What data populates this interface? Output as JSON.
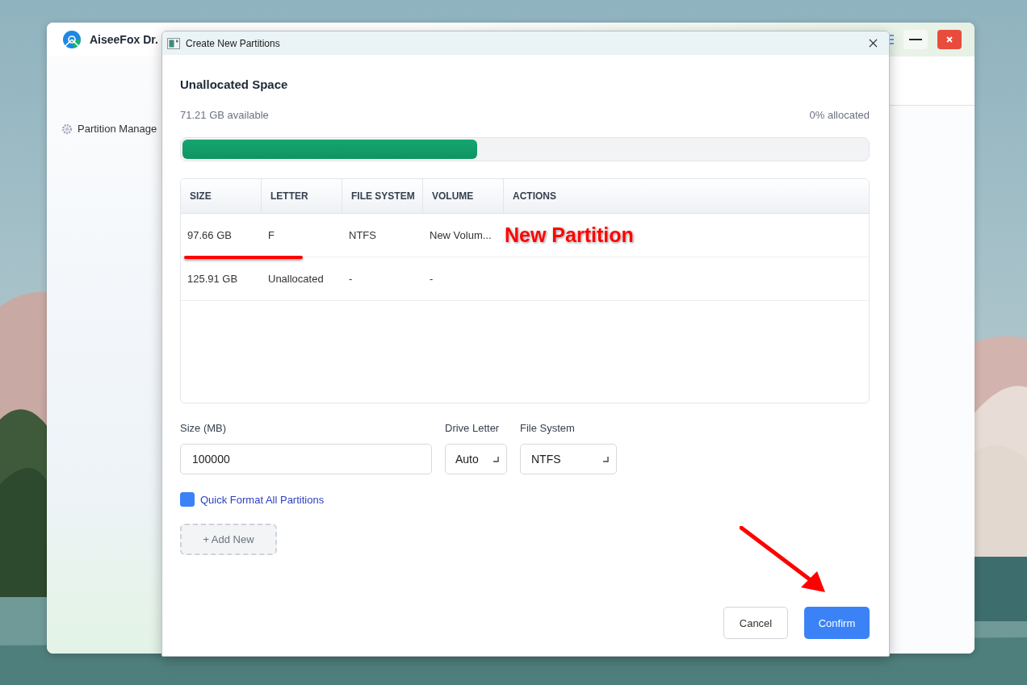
{
  "app": {
    "title": "AiseeFox Dr.",
    "sidebar_items": [
      {
        "label": "Partition Manage"
      }
    ]
  },
  "dialog": {
    "title": "Create New Partitions",
    "heading": "Unallocated Space",
    "available": "71.21 GB available",
    "allocated": "0% allocated",
    "allocation_bar": {
      "level": 0.43
    },
    "table": {
      "columns": [
        "SIZE",
        "LETTER",
        "FILE SYSTEM",
        "VOLUME",
        "ACTIONS"
      ],
      "rows": [
        {
          "cells": [
            "97.66 GB",
            "F",
            "NTFS",
            "New Volum..."
          ]
        },
        {
          "cells": [
            "125.91 GB",
            "Unallocated",
            "-",
            "-"
          ]
        }
      ]
    },
    "form": {
      "size_label": "Size (MB)",
      "size_value": "100000",
      "drive_letter_label": "Drive Letter",
      "drive_letter_value": "Auto",
      "file_system_label": "File System",
      "file_system_value": "NTFS"
    },
    "quick_format": {
      "label": "Quick Format All Partitions",
      "checked": true
    },
    "add_button": "+ Add New",
    "buttons": [
      {
        "label": "Cancel",
        "kind": "secondary"
      },
      {
        "label": "Confirm",
        "kind": "primary"
      }
    ]
  },
  "annotations": [
    {
      "kind": "label",
      "text": "New Partition"
    },
    {
      "kind": "underline"
    },
    {
      "kind": "arrow"
    }
  ]
}
